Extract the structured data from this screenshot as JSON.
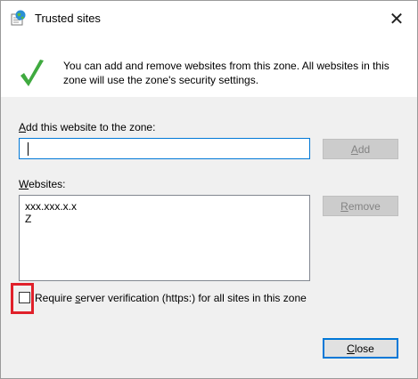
{
  "window": {
    "title": "Trusted sites",
    "close_glyph": "✕"
  },
  "info": {
    "text": "You can add and remove websites from this zone. All websites in this zone will use the zone's security settings."
  },
  "add_section": {
    "label_first": "A",
    "label_rest": "dd this website to the zone:",
    "input_value": "",
    "add_button_first": "A",
    "add_button_rest": "dd",
    "add_button_enabled": false
  },
  "websites_section": {
    "label_first": "W",
    "label_rest": "ebsites:",
    "items": [
      "xxx.xxx.x.x",
      "Z"
    ],
    "remove_button_first": "R",
    "remove_button_rest": "emove",
    "remove_button_enabled": false
  },
  "verification": {
    "label_before": "Require ",
    "label_underline": "s",
    "label_after": "erver verification (https:) for all sites in this zone",
    "checked": false,
    "highlight_color": "#e0202a"
  },
  "footer": {
    "close_first": "C",
    "close_rest": "lose"
  }
}
